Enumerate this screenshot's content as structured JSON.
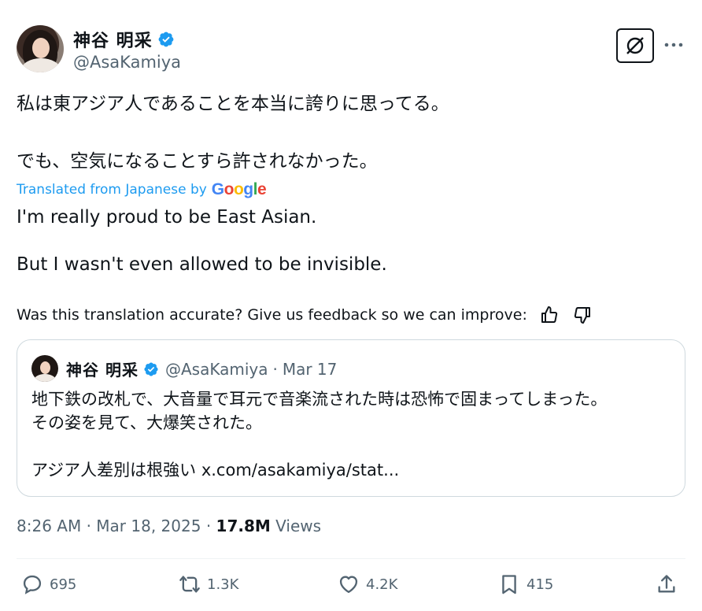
{
  "author": {
    "display_name": "神谷 明采",
    "handle": "@AsaKamiya"
  },
  "tweet": {
    "jp_line1": "私は東アジア人であることを本当に誇りに思ってる。",
    "jp_line2": "でも、空気になることすら許されなかった。",
    "translated_label": "Translated from Japanese by",
    "translator": "Google",
    "en_line1": "I'm really proud to be East Asian.",
    "en_line2": "But I wasn't even allowed to be invisible.",
    "feedback_prompt": "Was this translation accurate? Give us feedback so we can improve:"
  },
  "quote": {
    "display_name": "神谷 明采",
    "handle": "@AsaKamiya",
    "date": "Mar 17",
    "line1": "地下鉄の改札で、大音量で耳元で音楽流された時は恐怖で固まってしまった。",
    "line2": "その姿を見て、大爆笑された。",
    "line3": "アジア人差別は根強い x.com/asakamiya/stat..."
  },
  "meta": {
    "time": "8:26 AM",
    "date": "Mar 18, 2025",
    "views_count": "17.8M",
    "views_label": "Views"
  },
  "actions": {
    "replies": "695",
    "reposts": "1.3K",
    "likes": "4.2K",
    "bookmarks": "415"
  },
  "colors": {
    "accent": "#1d9bf0",
    "secondary_text": "#536471",
    "border": "#cfd9de"
  }
}
